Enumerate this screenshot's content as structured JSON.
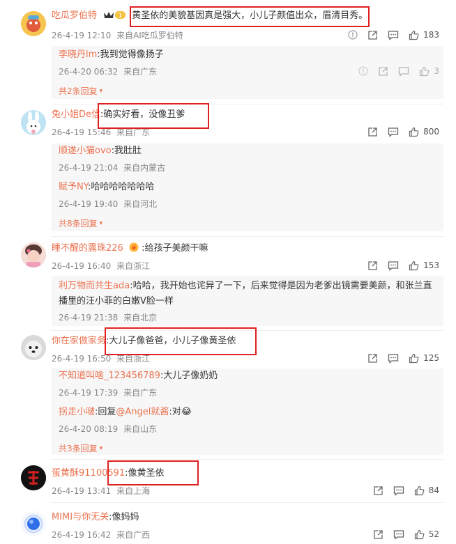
{
  "comments": [
    {
      "username": "吃瓜罗伯特",
      "text": "黄圣依的美貌基因真是强大，小儿子颜值出众，眉清目秀。",
      "date": "26-4-19 12:10",
      "location": "来自AI吃瓜罗伯特",
      "likes": "183",
      "replies": [
        {
          "username": "李晓丹lm",
          "text": ":我到觉得像扬子",
          "date": "26-4-20 06:32",
          "location": "来自广东",
          "likes": "3"
        }
      ],
      "more_label": "共2条回复"
    },
    {
      "username": "兔小姐De信",
      "text": ":确实好看，没像丑爹",
      "date": "26-4-19 15:46",
      "location": "来自广东",
      "likes": "800",
      "replies": [
        {
          "username": "顺遂小猫ovo",
          "text": ":我肚肚",
          "date": "26-4-19 21:04",
          "location": "来自内蒙古"
        },
        {
          "username": "赋予NY",
          "text": ":哈哈哈哈哈哈哈",
          "date": "26-4-19 19:40",
          "location": "来自河北"
        }
      ],
      "more_label": "共8条回复"
    },
    {
      "username": "睡不醒的露珠226",
      "text": ":给孩子美颜干嘛",
      "date": "26-4-19 16:40",
      "location": "来自浙江",
      "likes": "153",
      "replies": [
        {
          "username": "利万物而共生ada",
          "text": ":哈哈，我开始也诧异了一下，后来觉得是因为老爹出镜需要美颜，和张兰直",
          "text2": "播里的汪小菲的白嫩V脸一样",
          "date": "26-4-19 21:38",
          "location": "来自北京"
        }
      ]
    },
    {
      "username": "你在家做家务",
      "text": ":大儿子像爸爸，小儿子像黄圣依",
      "date": "26-4-19 16:50",
      "location": "来自浙江",
      "likes": "125",
      "replies": [
        {
          "username": "不知道叫啥_123456789",
          "text": ":大儿子像奶奶",
          "date": "26-4-19 17:39",
          "location": "来自广东"
        },
        {
          "username": "拐走小啵",
          "text": ":回复",
          "mention": "@Angel就酱",
          "text_after": ":对😂",
          "date": "26-4-20 08:19",
          "location": "来自山东"
        }
      ],
      "more_label": "共3条回复"
    },
    {
      "username": "蛋黄酥91100591",
      "text": ":像黄圣依",
      "date": "26-4-19 13:41",
      "location": "来自上海",
      "likes": "84",
      "replies": []
    },
    {
      "username": "MIMI与你无关",
      "text": ":像妈妈",
      "date": "26-4-19 16:42",
      "location": "来自广西",
      "likes": "52",
      "replies": []
    }
  ],
  "icons": {
    "forward": "forward-icon",
    "comment": "comment-icon",
    "like": "thumbs-up-icon",
    "report": "report-icon",
    "expand_arrow": "▾"
  },
  "colors": {
    "username": "#eb7350",
    "highlight": "#e02020",
    "meta": "#888888"
  }
}
